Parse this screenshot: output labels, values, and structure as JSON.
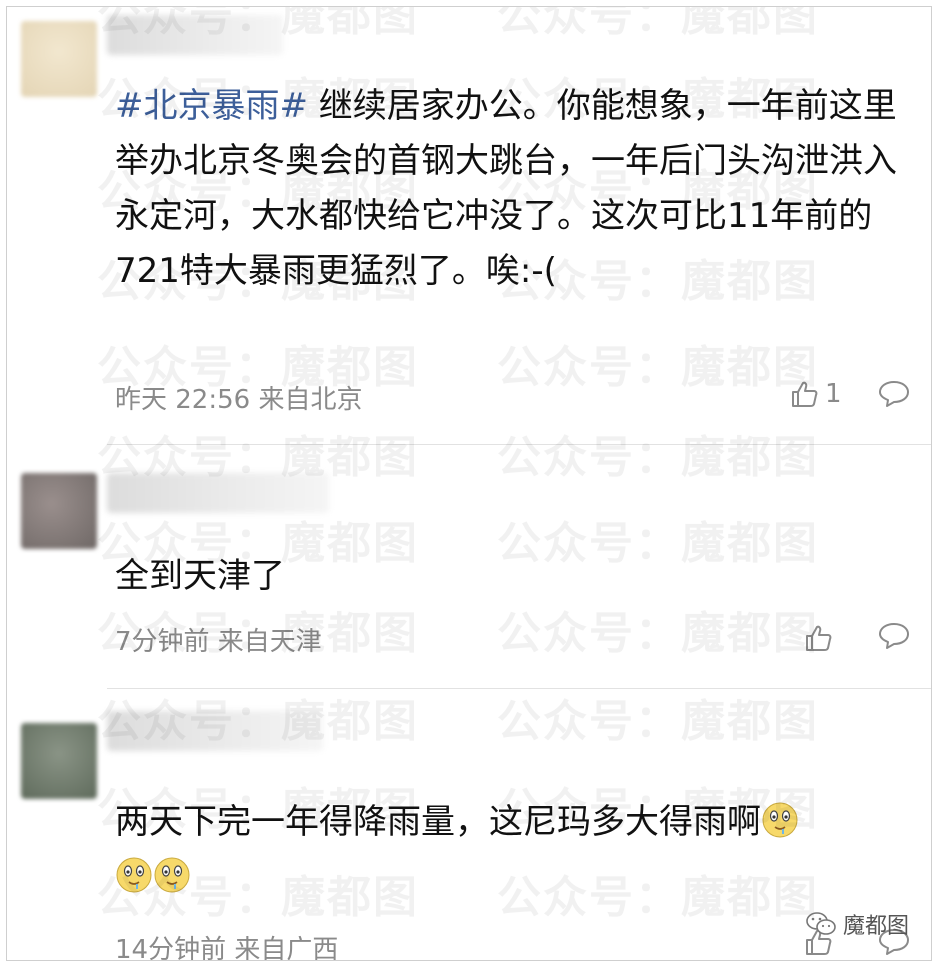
{
  "watermark_text": "公众号：魔都图",
  "comments": [
    {
      "hashtag": "#北京暴雨#",
      "text": " 继续居家办公。你能想象，一年前这里举办北京冬奥会的首钢大跳台，一年后门头沟泄洪入永定河，大水都快给它冲没了。这次可比11年前的721特大暴雨更猛烈了。唉:-(",
      "time": "昨天 22:56 来自北京",
      "likes": "1"
    },
    {
      "text": "全到天津了",
      "time": "7分钟前 来自天津",
      "likes": ""
    },
    {
      "text": "两天下完一年得降雨量，这尼玛多大得雨啊",
      "emoji": "drooling-face-emoji",
      "time": "14分钟前 来自广西",
      "likes": ""
    }
  ],
  "brand": {
    "label": "魔都图",
    "icon": "wechat-icon"
  },
  "colors": {
    "hashtag": "#3d5f9a",
    "meta": "#8a8a8a",
    "text": "#111111"
  }
}
